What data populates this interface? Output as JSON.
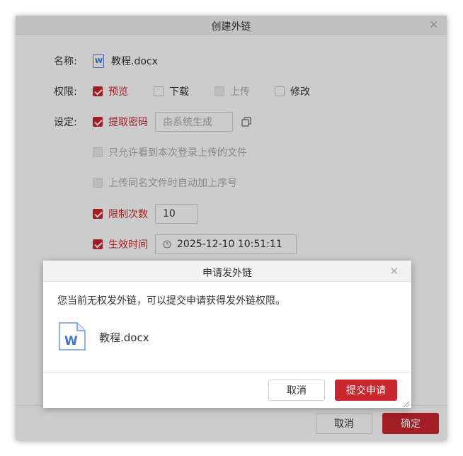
{
  "outer_dialog": {
    "title": "创建外链",
    "name_label": "名称:",
    "file_name": "教程.docx",
    "permission_label": "权限:",
    "permissions": [
      {
        "label": "预览",
        "checked": true,
        "disabled": false
      },
      {
        "label": "下载",
        "checked": false,
        "disabled": false
      },
      {
        "label": "上传",
        "checked": false,
        "disabled": true
      },
      {
        "label": "修改",
        "checked": false,
        "disabled": false
      }
    ],
    "settings_label": "设定:",
    "extract_password": {
      "label": "提取密码",
      "checked": true,
      "placeholder": "由系统生成"
    },
    "only_see_own_uploads": {
      "label": "只允许看到本次登录上传的文件",
      "checked": false,
      "disabled": true
    },
    "auto_sequence": {
      "label": "上传同名文件时自动加上序号",
      "checked": false,
      "disabled": true
    },
    "limit_count": {
      "label": "限制次数",
      "checked": true,
      "value": "10"
    },
    "effective_time": {
      "label": "生效时间",
      "checked": true,
      "value": "2025-12-10 10:51:11"
    },
    "cancel_label": "取消",
    "ok_label": "确定"
  },
  "inner_dialog": {
    "title": "申请发外链",
    "message": "您当前无权发外链，可以提交申请获得发外链权限。",
    "file_name": "教程.docx",
    "file_icon_letter": "W",
    "cancel_label": "取消",
    "submit_label": "提交申请"
  },
  "colors": {
    "accent": "#c9262d",
    "word_blue": "#3f73cf"
  }
}
